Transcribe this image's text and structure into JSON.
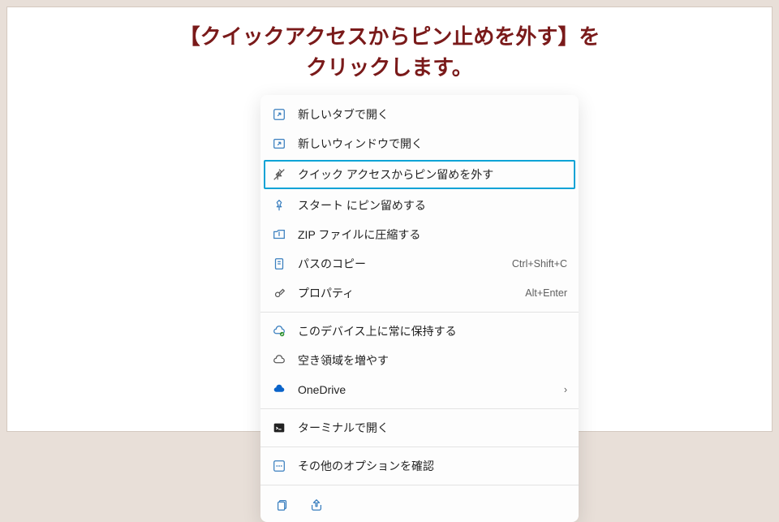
{
  "title_line1": "【クイックアクセスからピン止めを外す】を",
  "title_line2": "クリックします。",
  "highlight_color": "#0aa3d6",
  "menu": {
    "group1": [
      {
        "icon": "new-tab-icon",
        "label": "新しいタブで開く"
      },
      {
        "icon": "new-window-icon",
        "label": "新しいウィンドウで開く"
      },
      {
        "icon": "unpin-icon",
        "label": "クイック アクセスからピン留めを外す",
        "highlighted": true
      },
      {
        "icon": "pin-icon",
        "label": "スタート にピン留めする"
      },
      {
        "icon": "zip-icon",
        "label": "ZIP ファイルに圧縮する"
      },
      {
        "icon": "copy-path-icon",
        "label": "パスのコピー",
        "shortcut": "Ctrl+Shift+C"
      },
      {
        "icon": "properties-icon",
        "label": "プロパティ",
        "shortcut": "Alt+Enter"
      }
    ],
    "group2": [
      {
        "icon": "cloud-keep-icon",
        "label": "このデバイス上に常に保持する"
      },
      {
        "icon": "free-space-icon",
        "label": "空き領域を増やす"
      },
      {
        "icon": "onedrive-icon",
        "label": "OneDrive",
        "submenu": true
      }
    ],
    "group3": [
      {
        "icon": "terminal-icon",
        "label": "ターミナルで開く"
      }
    ],
    "group4": [
      {
        "icon": "more-options-icon",
        "label": "その他のオプションを確認"
      }
    ],
    "bottom": [
      {
        "icon": "copy-icon"
      },
      {
        "icon": "share-icon"
      }
    ]
  }
}
